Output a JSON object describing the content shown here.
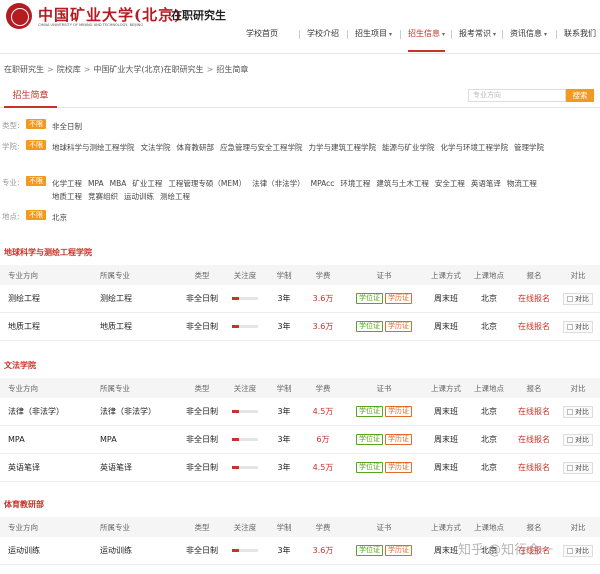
{
  "header": {
    "logo_cn": "中国矿业大学(北京)",
    "logo_en": "CHINA UNIVERSITY OF MINING AND TECHNOLOGY, BEIJING",
    "site_name": "在职研究生",
    "nav": [
      {
        "label": "学校首页",
        "has_dropdown": false,
        "active": false
      },
      {
        "label": "学校介绍",
        "has_dropdown": false,
        "active": false
      },
      {
        "label": "招生项目",
        "has_dropdown": true,
        "active": false
      },
      {
        "label": "招生信息",
        "has_dropdown": true,
        "active": true
      },
      {
        "label": "报考常识",
        "has_dropdown": true,
        "active": false
      },
      {
        "label": "资讯信息",
        "has_dropdown": true,
        "active": false
      },
      {
        "label": "联系我们",
        "has_dropdown": false,
        "active": false
      }
    ]
  },
  "breadcrumb": [
    "在职研究生",
    "院校库",
    "中国矿业大学(北京)在职研究生",
    "招生简章"
  ],
  "tab": {
    "label": "招生简章"
  },
  "search": {
    "placeholder": "专业方向",
    "button": "搜索"
  },
  "filters": [
    {
      "label": "类型:",
      "tag": "不限",
      "options": [
        "非全日制"
      ]
    },
    {
      "label": "学院:",
      "tag": "不限",
      "options": [
        "地球科学与测绘工程学院",
        "文法学院",
        "体育教研部",
        "应急管理与安全工程学院",
        "力学与建筑工程学院",
        "能源与矿业学院",
        "化学与环境工程学院",
        "管理学院"
      ]
    },
    {
      "label": "专业:",
      "tag": "不限",
      "options": [
        "化学工程",
        "MPA",
        "MBA",
        "矿业工程",
        "工程管理专硕（MEM）",
        "法律（非法学）",
        "MPAcc",
        "环境工程",
        "建筑与土木工程",
        "安全工程",
        "英语笔译",
        "物流工程",
        "地质工程",
        "竞赛组织",
        "运动训练",
        "测绘工程"
      ]
    },
    {
      "label": "地点:",
      "tag": "不限",
      "options": [
        "北京"
      ]
    }
  ],
  "table_headers": [
    "专业方向",
    "所属专业",
    "类型",
    "关注度",
    "学制",
    "学费",
    "证书",
    "上课方式",
    "上课地点",
    "报名",
    "对比"
  ],
  "sections": [
    {
      "title": "地球科学与测绘工程学院",
      "rows": [
        {
          "major": "测绘工程",
          "sub": "测绘工程",
          "type": "非全日制",
          "attention": 0.25,
          "years": "3年",
          "fee": "3.6万",
          "certs": [
            "学位证",
            "学历证"
          ],
          "mode": "周末班",
          "place": "北京",
          "apply": "在线报名",
          "compare": "对比"
        },
        {
          "major": "地质工程",
          "sub": "地质工程",
          "type": "非全日制",
          "attention": 0.25,
          "years": "3年",
          "fee": "3.6万",
          "certs": [
            "学位证",
            "学历证"
          ],
          "mode": "周末班",
          "place": "北京",
          "apply": "在线报名",
          "compare": "对比"
        }
      ]
    },
    {
      "title": "文法学院",
      "rows": [
        {
          "major": "法律（非法学）",
          "sub": "法律（非法学）",
          "type": "非全日制",
          "attention": 0.25,
          "years": "3年",
          "fee": "4.5万",
          "certs": [
            "学位证",
            "学历证"
          ],
          "mode": "周末班",
          "place": "北京",
          "apply": "在线报名",
          "compare": "对比"
        },
        {
          "major": "MPA",
          "sub": "MPA",
          "type": "非全日制",
          "attention": 0.25,
          "years": "3年",
          "fee": "6万",
          "certs": [
            "学位证",
            "学历证"
          ],
          "mode": "周末班",
          "place": "北京",
          "apply": "在线报名",
          "compare": "对比"
        },
        {
          "major": "英语笔译",
          "sub": "英语笔译",
          "type": "非全日制",
          "attention": 0.25,
          "years": "3年",
          "fee": "4.5万",
          "certs": [
            "学位证",
            "学历证"
          ],
          "mode": "周末班",
          "place": "北京",
          "apply": "在线报名",
          "compare": "对比"
        }
      ]
    },
    {
      "title": "体育教研部",
      "rows": [
        {
          "major": "运动训练",
          "sub": "运动训练",
          "type": "非全日制",
          "attention": 0.25,
          "years": "3年",
          "fee": "3.6万",
          "certs": [
            "学位证",
            "学历证"
          ],
          "mode": "周末班",
          "place": "北京",
          "apply": "在线报名",
          "compare": "对比"
        }
      ]
    }
  ],
  "watermark": "知乎 @知行合一",
  "colors": {
    "accent": "#c93227",
    "tag": "#f29a1f",
    "degree_badge": "#5aa51e",
    "diploma_badge": "#e06b2a"
  }
}
